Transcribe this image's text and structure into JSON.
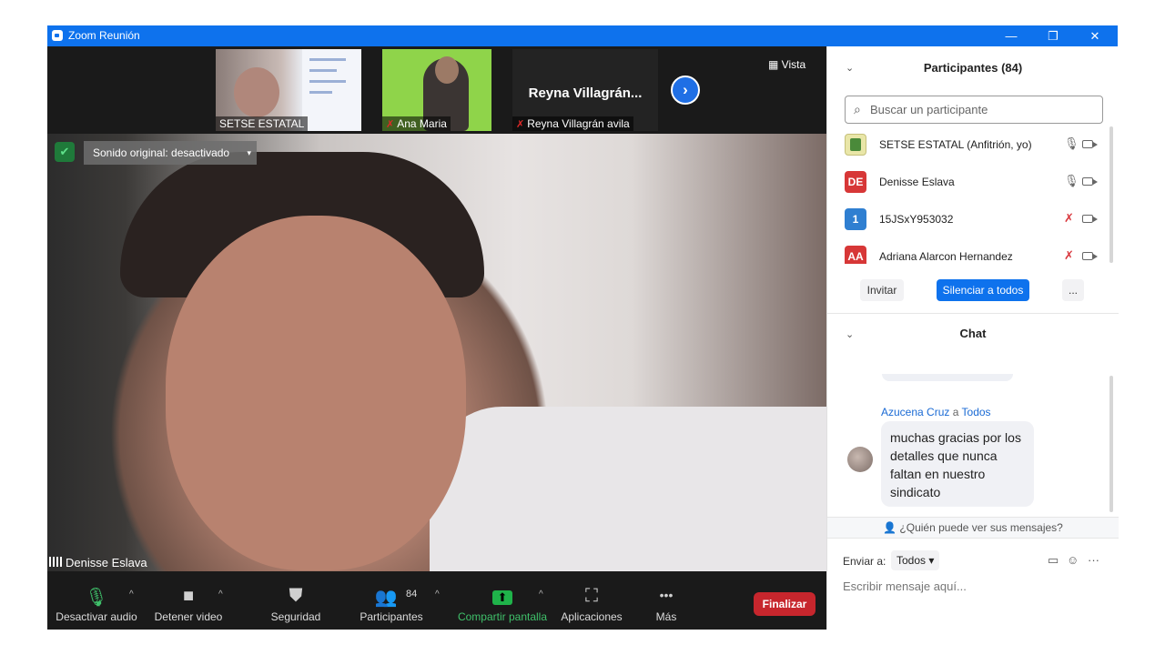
{
  "window": {
    "title": "Zoom Reunión",
    "minimize": "—",
    "restore": "❐",
    "close": "✕"
  },
  "gallery": {
    "tiles": [
      {
        "name": "SETSE ESTATAL",
        "muted": false
      },
      {
        "name": "Ana Maria",
        "muted": true
      },
      {
        "name": "Reyna Villagrán avila",
        "big_label": "Reyna  Villagrán...",
        "muted": true
      }
    ],
    "next_icon": "›",
    "view_label": "Vista"
  },
  "video": {
    "sound_label": "Sonido original: desactivado",
    "caret": "▾",
    "speaker": "Denisse Eslava",
    "shield_icon": "✔"
  },
  "toolbar": {
    "audio": "Desactivar audio",
    "video": "Detener video",
    "security": "Seguridad",
    "participants": "Participantes",
    "participants_count": "84",
    "share": "Compartir pantalla",
    "apps": "Aplicaciones",
    "more": "Más",
    "end": "Finalizar",
    "caret": "^",
    "mic_icon": "🎙",
    "cam_icon": "■",
    "shield_icon": "⛊",
    "people_icon": "👥",
    "share_icon": "⬆",
    "apps_icon": "⛶",
    "more_icon": "•••"
  },
  "participants": {
    "header": "Participantes (84)",
    "collapse": "⌄",
    "search_placeholder": "Buscar un participante",
    "search_icon": "⌕",
    "list": [
      {
        "initials": "",
        "name": "SETSE ESTATAL (Anfitrión, yo)",
        "color": "#e9e6a8",
        "mic": "🎙",
        "muted": false
      },
      {
        "initials": "DE",
        "name": "Denisse Eslava",
        "color": "#d73737",
        "mic": "🎙",
        "muted": false
      },
      {
        "initials": "1",
        "name": "15JSxY953032",
        "color": "#2f7fd1",
        "mic": "✗",
        "muted": true
      },
      {
        "initials": "AA",
        "name": "Adriana Alarcon Hernandez",
        "color": "#d73737",
        "mic": "✗",
        "muted": true
      }
    ],
    "invite": "Invitar",
    "mute_all": "Silenciar a todos",
    "more": "..."
  },
  "chat": {
    "header": "Chat",
    "collapse": "⌄",
    "sender": "Azucena Cruz",
    "to_word": "a",
    "recipient": "Todos",
    "message": "muchas gracias por los detalles que nunca faltan en nuestro sindicato",
    "who_can_see": "¿Quién puede ver sus mensajes?",
    "send_to_label": "Enviar a:",
    "send_to_value": "Todos",
    "dropdown_icon": "▾",
    "file_icon": "▭",
    "emoji_icon": "☺",
    "more_icon": "···",
    "input_placeholder": "Escribir mensaje aquí..."
  }
}
